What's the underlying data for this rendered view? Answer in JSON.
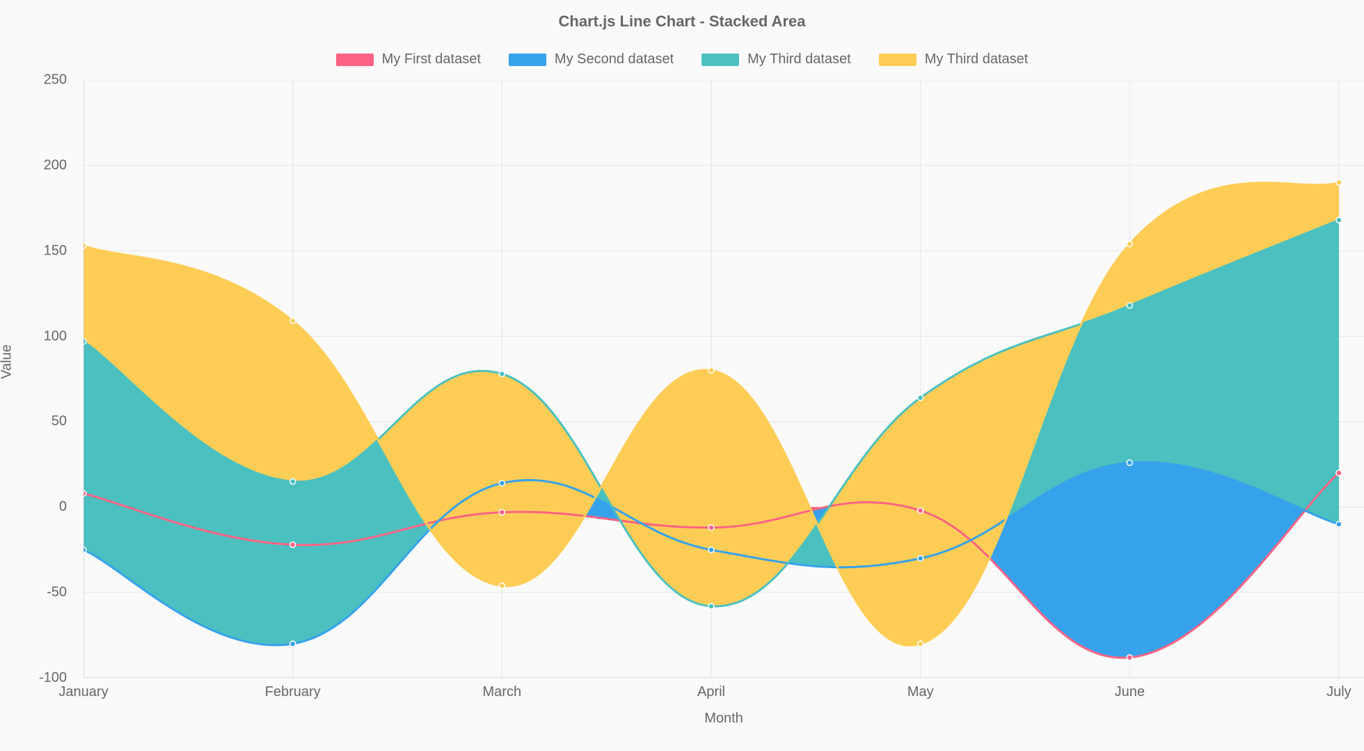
{
  "chart_data": {
    "type": "area",
    "stacked": true,
    "title": "Chart.js Line Chart - Stacked Area",
    "xlabel": "Month",
    "ylabel": "Value",
    "ylim": [
      -100,
      250
    ],
    "yticks": [
      -100,
      -50,
      0,
      50,
      100,
      150,
      200,
      250
    ],
    "categories": [
      "January",
      "February",
      "March",
      "April",
      "May",
      "June",
      "July"
    ],
    "series": [
      {
        "name": "My First dataset",
        "color": "#ff6384",
        "values": [
          8,
          -22,
          -3,
          -12,
          -2,
          -88,
          20
        ]
      },
      {
        "name": "My Second dataset",
        "color": "#36a2eb",
        "values": [
          -33,
          -58,
          17,
          -13,
          -28,
          114,
          -30
        ]
      },
      {
        "name": "My Third dataset",
        "color": "#4bc0c0",
        "values": [
          122,
          95,
          64,
          -33,
          94,
          92,
          178
        ]
      },
      {
        "name": "My Third dataset",
        "color": "#ffcd56",
        "values": [
          56,
          94,
          -124,
          138,
          -144,
          36,
          22
        ]
      }
    ],
    "legend_position": "top"
  }
}
